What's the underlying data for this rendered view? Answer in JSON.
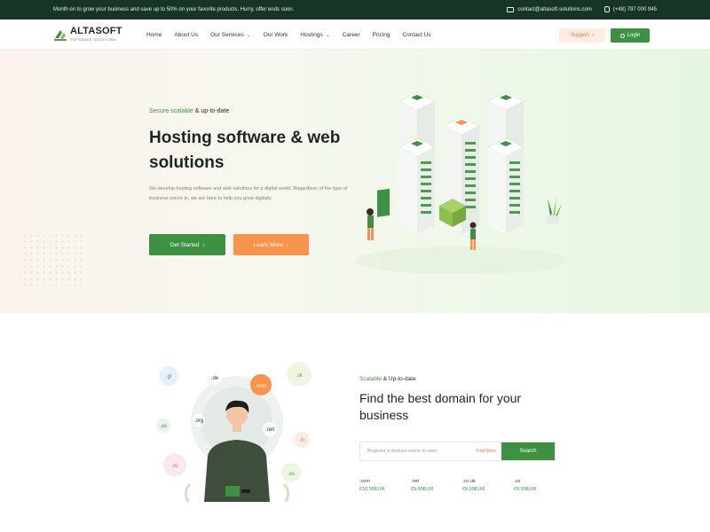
{
  "topbar": {
    "promo": "Month on to grow your business and save up to 50% on your favorite products. Hurry, offer ends soon.",
    "email": "contact@altasoft-solutions.com",
    "phone": "(+48) 797 000 945"
  },
  "brand": {
    "name": "ALTASOFT",
    "tagline": "SOFTWARE SOLUTIONS",
    "color": "#3e9142",
    "accent": "#f7934c",
    "dark": "#173526"
  },
  "nav": {
    "items": [
      {
        "label": "Home",
        "dropdown": false
      },
      {
        "label": "About Us",
        "dropdown": false
      },
      {
        "label": "Our Services",
        "dropdown": true
      },
      {
        "label": "Our Work",
        "dropdown": false
      },
      {
        "label": "Hostings",
        "dropdown": true
      },
      {
        "label": "Career",
        "dropdown": false
      },
      {
        "label": "Pricing",
        "dropdown": false
      },
      {
        "label": "Contact Us",
        "dropdown": false
      }
    ],
    "support_label": "Support",
    "login_label": "Login"
  },
  "hero": {
    "eyebrow_green": "Secure scalable",
    "eyebrow_rest": " & up-to-date",
    "title": "Hosting software & web solutions",
    "description": "We develop hosting software and web solutions for a digital world. Regardless of the type of business you're in, we are here to help you grow digitally.",
    "primary_button": "Get Started",
    "secondary_button": "Learn More"
  },
  "domain": {
    "eyebrow_green": "Scalable",
    "eyebrow_rest": " & Up-to-date",
    "title": "Find the best domain for your business",
    "search_placeholder": "Register a domain name to start",
    "find_more": "Find More",
    "search_button": "Search",
    "prices": [
      {
        "tld": ".com",
        "price": "€10.99EUR"
      },
      {
        "tld": ".net",
        "price": "€9.99EUR"
      },
      {
        "tld": ".co.uk",
        "price": "€9.99EUR"
      },
      {
        "tld": ".us",
        "price": "€9.99EUR"
      }
    ],
    "bubbles": [
      ".gl",
      ".de",
      ".uk",
      ".com",
      ".us",
      ".org",
      ".net",
      ".in",
      ".ru",
      ".au"
    ]
  }
}
